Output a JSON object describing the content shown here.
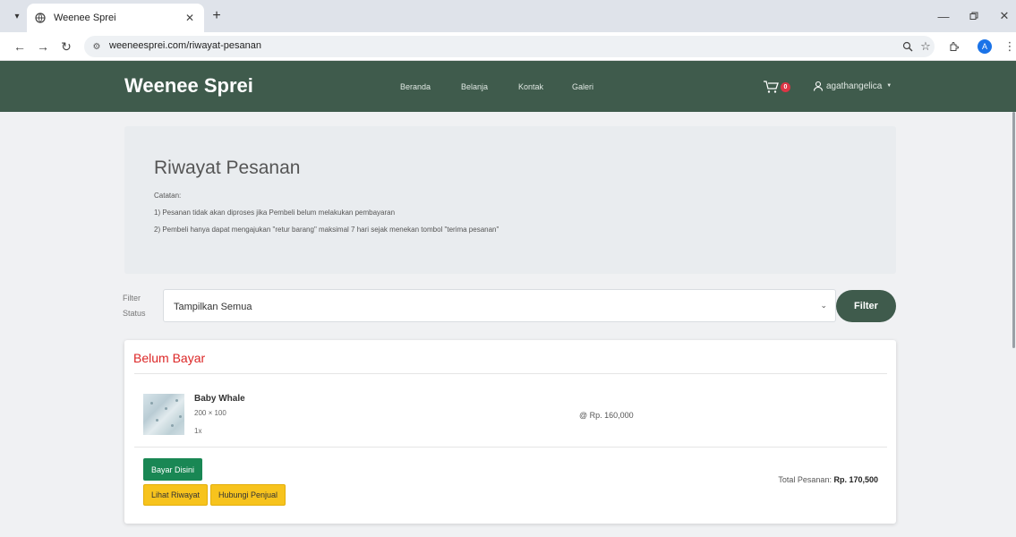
{
  "browser": {
    "tab_title": "Weenee Sprei",
    "url": "weeneesprei.com/riwayat-pesanan",
    "profile_initial": "A"
  },
  "site": {
    "brand": "Weenee Sprei",
    "nav": [
      "Beranda",
      "Belanja",
      "Kontak",
      "Galeri"
    ],
    "cart_count": "0",
    "username": "agathangelica",
    "colors": {
      "header": "#3f5b4c",
      "badge": "#dc3545"
    }
  },
  "page": {
    "title": "Riwayat Pesanan",
    "notes_heading": "Catatan:",
    "notes": [
      "1) Pesanan tidak akan diproses jika Pembeli belum melakukan pembayaran",
      "2) Pembeli hanya dapat mengajukan \"retur barang\" maksimal 7 hari sejak menekan tombol \"terima pesanan\""
    ]
  },
  "filter": {
    "label_line1": "Filter",
    "label_line2": "Status",
    "selected": "Tampilkan Semua",
    "button": "Filter"
  },
  "order": {
    "status": "Belum Bayar",
    "item": {
      "name": "Baby Whale",
      "size": "200 × 100",
      "qty": "1x",
      "price": "@ Rp. 160,000"
    },
    "buttons": {
      "pay": "Bayar Disini",
      "history": "Lihat Riwayat",
      "contact": "Hubungi Penjual"
    },
    "total_label": "Total Pesanan:",
    "total_value": "Rp. 170,500"
  }
}
